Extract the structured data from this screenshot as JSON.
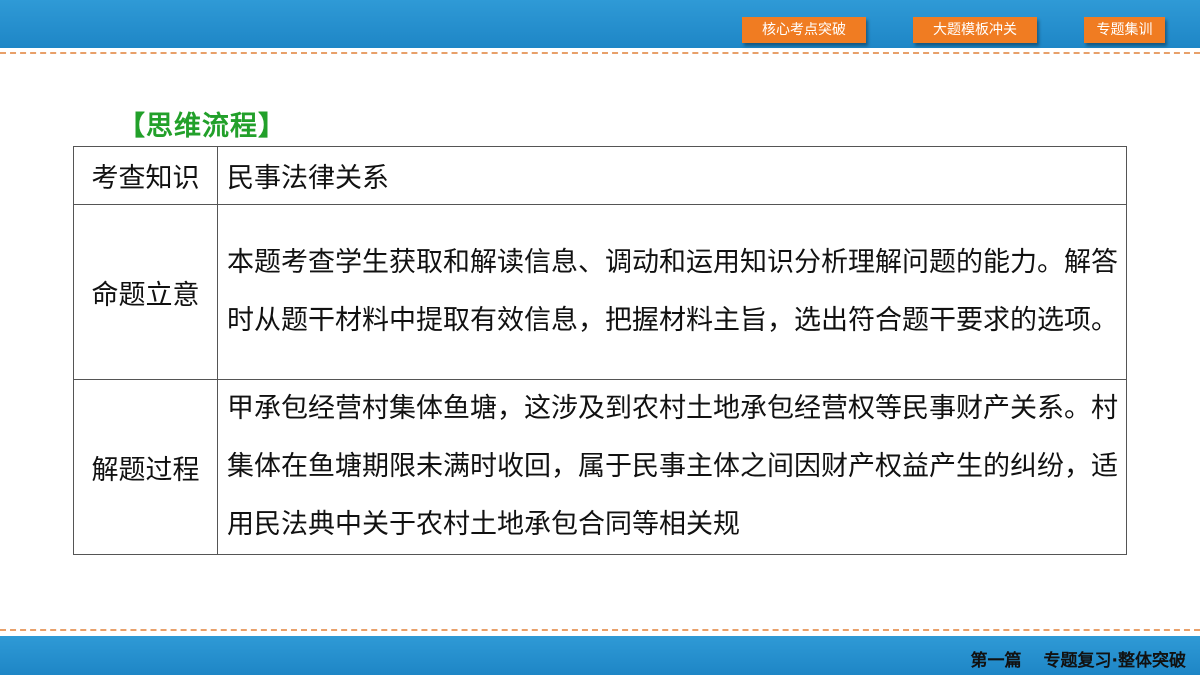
{
  "nav": {
    "tab1": "核心考点突破",
    "tab2": "大题模板冲关",
    "tab3": "专题集训"
  },
  "section_title": "【思维流程】",
  "table": {
    "row1": {
      "label": "考查知识",
      "content": "民事法律关系"
    },
    "row2": {
      "label": "命题立意",
      "content": "本题考查学生获取和解读信息、调动和运用知识分析理解问题的能力。解答时从题干材料中提取有效信息，把握材料主旨，选出符合题干要求的选项。"
    },
    "row3": {
      "label": "解题过程",
      "content": "甲承包经营村集体鱼塘，这涉及到农村土地承包经营权等民事财产关系。村集体在鱼塘期限未满时收回，属于民事主体之间因财产权益产生的纠纷，适用民法典中关于农村土地承包合同等相关规"
    }
  },
  "footer": {
    "part": "第一篇",
    "title": "专题复习·整体突破"
  },
  "colors": {
    "band": "#1e86c6",
    "nav_button": "#f07c22",
    "title_green": "#22a02a",
    "dash": "#e8a06a"
  }
}
